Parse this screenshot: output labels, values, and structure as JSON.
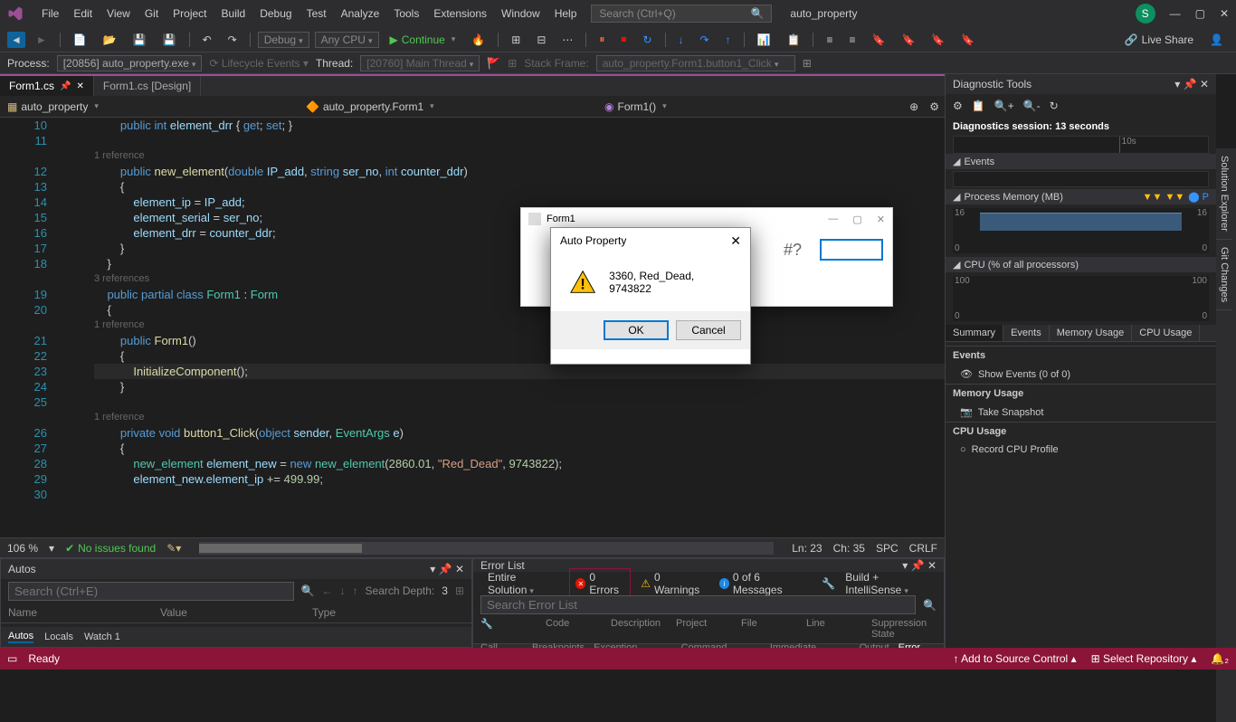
{
  "titlebar": {
    "menus": [
      "File",
      "Edit",
      "View",
      "Git",
      "Project",
      "Build",
      "Debug",
      "Test",
      "Analyze",
      "Tools",
      "Extensions",
      "Window",
      "Help"
    ],
    "search_placeholder": "Search (Ctrl+Q)",
    "project_name": "auto_property",
    "avatar_letter": "S"
  },
  "toolbar": {
    "config": "Debug",
    "platform": "Any CPU",
    "continue": "Continue",
    "live_share": "Live Share"
  },
  "processbar": {
    "process_label": "Process:",
    "process_value": "[20856] auto_property.exe",
    "lifecycle": "Lifecycle Events",
    "thread_label": "Thread:",
    "thread_value": "[20760] Main Thread",
    "stackframe_label": "Stack Frame:",
    "stackframe_value": "auto_property.Form1.button1_Click"
  },
  "tabs": {
    "active": "Form1.cs",
    "inactive": "Form1.cs [Design]"
  },
  "navbar": {
    "ns": "auto_property",
    "class": "auto_property.Form1",
    "method": "Form1()"
  },
  "editor": {
    "lines": [
      {
        "n": 10,
        "html": "        <span class='kw'>public</span> <span class='kw'>int</span> <span class='param'>element_drr</span> { <span class='kw'>get</span>; <span class='kw'>set</span>; }"
      },
      {
        "n": 11,
        "html": ""
      },
      {
        "n": "",
        "ref": "        1 reference"
      },
      {
        "n": 12,
        "html": "        <span class='kw'>public</span> <span class='method'>new_element</span>(<span class='kw'>double</span> <span class='param'>IP_add</span>, <span class='kw'>string</span> <span class='param'>ser_no</span>, <span class='kw'>int</span> <span class='param'>counter_ddr</span>)"
      },
      {
        "n": 13,
        "html": "        {"
      },
      {
        "n": 14,
        "html": "            <span class='param'>element_ip</span> = <span class='param'>IP_add</span>;"
      },
      {
        "n": 15,
        "html": "            <span class='param'>element_serial</span> = <span class='param'>ser_no</span>;"
      },
      {
        "n": 16,
        "html": "            <span class='param'>element_drr</span> = <span class='param'>counter_ddr</span>;"
      },
      {
        "n": 17,
        "html": "        }"
      },
      {
        "n": 18,
        "html": "    }"
      },
      {
        "n": "",
        "ref": "    3 references"
      },
      {
        "n": 19,
        "html": "    <span class='kw'>public</span> <span class='kw'>partial</span> <span class='kw'>class</span> <span class='type'>Form1</span> : <span class='type'>Form</span>"
      },
      {
        "n": 20,
        "html": "    {"
      },
      {
        "n": "",
        "ref": "        1 reference"
      },
      {
        "n": 21,
        "html": "        <span class='kw'>public</span> <span class='method'>Form1</span>()"
      },
      {
        "n": 22,
        "html": "        {"
      },
      {
        "n": 23,
        "html": "            <span class='method'>InitializeComponent</span>();",
        "hl": true
      },
      {
        "n": 24,
        "html": "        }"
      },
      {
        "n": 25,
        "html": ""
      },
      {
        "n": "",
        "ref": "        1 reference"
      },
      {
        "n": 26,
        "html": "        <span class='kw'>private</span> <span class='kw'>void</span> <span class='method'>button1_Click</span>(<span class='kw'>object</span> <span class='param'>sender</span>, <span class='type'>EventArgs</span> <span class='param'>e</span>)"
      },
      {
        "n": 27,
        "html": "        {"
      },
      {
        "n": 28,
        "html": "            <span class='type'>new_element</span> <span class='param'>element_new</span> = <span class='kw'>new</span> <span class='type'>new_element</span>(<span class='num'>2860.01</span>, <span class='str'>\"Red_Dead\"</span>, <span class='num'>9743822</span>);"
      },
      {
        "n": 29,
        "html": "            <span class='param'>element_new</span>.<span class='param'>element_ip</span> += <span class='num'>499.99</span>;"
      },
      {
        "n": 30,
        "html": ""
      }
    ]
  },
  "editor_status": {
    "zoom": "106 %",
    "no_issues": "No issues found",
    "ln": "Ln: 23",
    "ch": "Ch: 35",
    "spc": "SPC",
    "crlf": "CRLF"
  },
  "autos": {
    "title": "Autos",
    "search_placeholder": "Search (Ctrl+E)",
    "depth_label": "Search Depth:",
    "depth_value": "3",
    "cols": [
      "Name",
      "Value",
      "Type"
    ],
    "tabs": [
      "Autos",
      "Locals",
      "Watch 1"
    ]
  },
  "errorlist": {
    "title": "Error List",
    "scope": "Entire Solution",
    "errors": "0 Errors",
    "warnings": "0 Warnings",
    "messages": "0 of 6 Messages",
    "filter": "Build + IntelliSense",
    "search_placeholder": "Search Error List",
    "cols": [
      "Code",
      "Description",
      "Project",
      "File",
      "Line",
      "Suppression State"
    ],
    "tabs_left": [
      "Call Stack",
      "Breakpoints",
      "Exception Settings",
      "Command Window",
      "Immediate Window",
      "Output"
    ],
    "tabs_active": "Error List"
  },
  "diag": {
    "title": "Diagnostic Tools",
    "session": "Diagnostics session: 13 seconds",
    "timeline_marker": "10s",
    "events_hdr": "Events",
    "memory_hdr": "Process Memory (MB)",
    "mem_max": "16",
    "mem_min": "0",
    "cpu_hdr": "CPU (% of all processors)",
    "cpu_max": "100",
    "cpu_min": "0",
    "tabs": [
      "Summary",
      "Events",
      "Memory Usage",
      "CPU Usage"
    ],
    "events_cat": "Events",
    "events_link": "Show Events (0 of 0)",
    "memory_cat": "Memory Usage",
    "memory_link": "Take Snapshot",
    "cpu_cat": "CPU Usage",
    "cpu_link": "Record CPU Profile"
  },
  "side_tabs": [
    "Solution Explorer",
    "Git Changes"
  ],
  "statusbar": {
    "ready": "Ready",
    "source_control": "Add to Source Control",
    "repo": "Select Repository"
  },
  "form1": {
    "title": "Form1",
    "hash": "#?"
  },
  "msgbox": {
    "title": "Auto Property",
    "text": "3360, Red_Dead, 9743822",
    "ok": "OK",
    "cancel": "Cancel"
  },
  "chart_data": [
    {
      "type": "area",
      "title": "Process Memory (MB)",
      "x": [
        0,
        13
      ],
      "values": [
        16,
        16
      ],
      "ylim": [
        0,
        16
      ],
      "ylabel": "MB"
    },
    {
      "type": "line",
      "title": "CPU (% of all processors)",
      "x": [
        0,
        13
      ],
      "values": [
        0,
        0
      ],
      "ylim": [
        0,
        100
      ],
      "ylabel": "%"
    }
  ]
}
